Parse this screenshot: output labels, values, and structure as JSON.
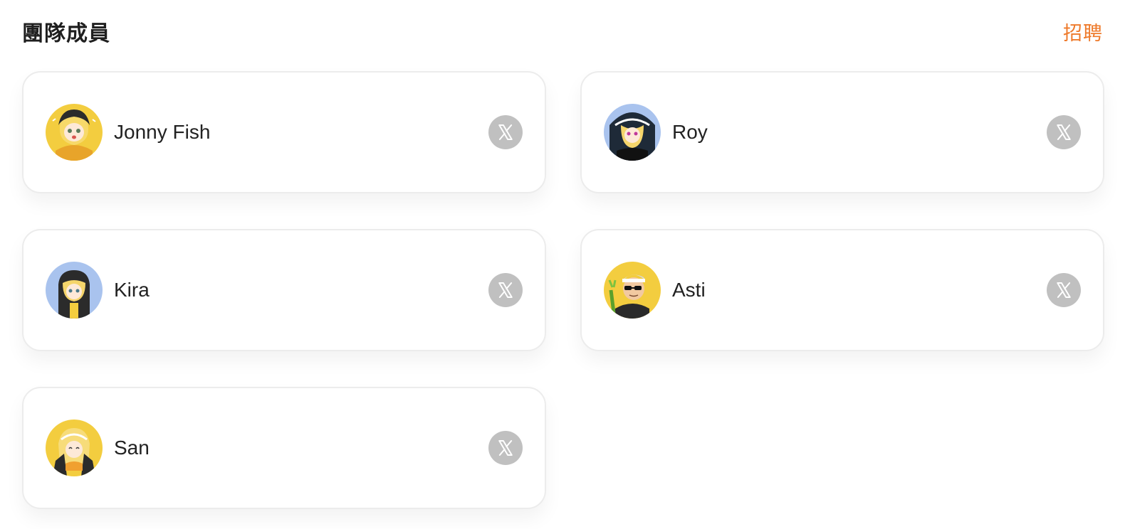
{
  "header": {
    "title": "團隊成員",
    "recruit_label": "招聘"
  },
  "colors": {
    "accent": "#ee7a2b",
    "icon_bg": "#c0c0c0",
    "avatar_yellow": "#f3cd3f",
    "avatar_blue": "#a9c3ee"
  },
  "members": [
    {
      "name": "Jonny Fish",
      "avatar_bg": "#f3cd3f",
      "social_icon": "x-logo-icon"
    },
    {
      "name": "Roy",
      "avatar_bg": "#a9c3ee",
      "social_icon": "x-logo-icon"
    },
    {
      "name": "Kira",
      "avatar_bg": "#a9c3ee",
      "social_icon": "x-logo-icon"
    },
    {
      "name": "Asti",
      "avatar_bg": "#f3cd3f",
      "social_icon": "x-logo-icon"
    },
    {
      "name": "San",
      "avatar_bg": "#f3cd3f",
      "social_icon": "x-logo-icon"
    }
  ]
}
